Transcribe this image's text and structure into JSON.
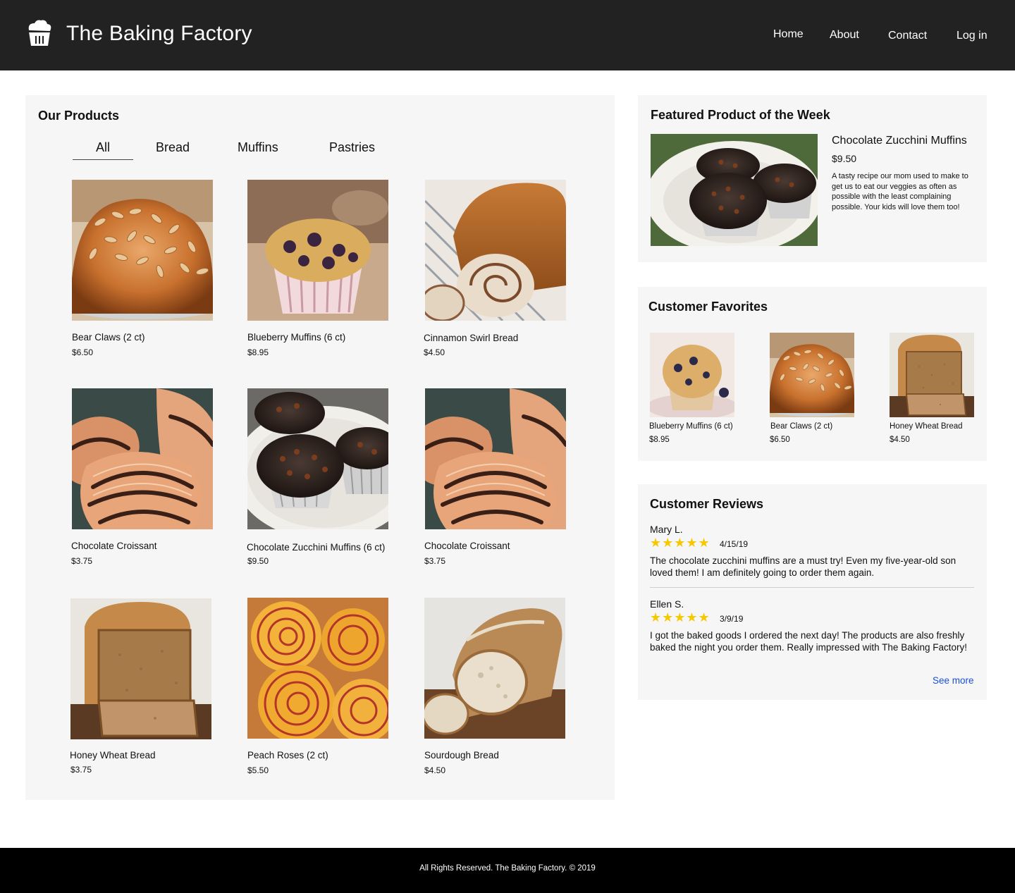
{
  "header": {
    "brand": "The Baking Factory",
    "logo_icon": "cupcake-icon",
    "nav": [
      "Home",
      "About",
      "Contact",
      "Log in"
    ]
  },
  "products": {
    "title": "Our Products",
    "tabs": [
      "All",
      "Bread",
      "Muffins",
      "Pastries"
    ],
    "active_tab": "All",
    "items": [
      {
        "name": "Bear Claws (2 ct)",
        "price": "$6.50",
        "image": "bear-claw-image"
      },
      {
        "name": "Blueberry Muffins (6 ct)",
        "price": "$8.95",
        "image": "blueberry-muffin-image"
      },
      {
        "name": "Cinnamon Swirl Bread",
        "price": "$4.50",
        "image": "cinnamon-swirl-bread-image"
      },
      {
        "name": "Chocolate Croissant",
        "price": "$3.75",
        "image": "chocolate-croissant-image"
      },
      {
        "name": "Chocolate Zucchini Muffins (6 ct)",
        "price": "$9.50",
        "image": "chocolate-muffin-image"
      },
      {
        "name": "Chocolate Croissant",
        "price": "$3.75",
        "image": "chocolate-croissant-image"
      },
      {
        "name": "Honey Wheat Bread",
        "price": "$3.75",
        "image": "honey-wheat-bread-image"
      },
      {
        "name": "Peach Roses (2 ct)",
        "price": "$5.50",
        "image": "peach-roses-image"
      },
      {
        "name": "Sourdough Bread",
        "price": "$4.50",
        "image": "sourdough-bread-image"
      }
    ]
  },
  "featured": {
    "title": "Featured Product of the Week",
    "name": "Chocolate Zucchini Muffins",
    "price": "$9.50",
    "description": "A tasty recipe our mom used to make to get us to eat our veggies as often as possible with the least complaining possible. Your kids will love them too!"
  },
  "favorites": {
    "title": "Customer Favorites",
    "items": [
      {
        "name": "Blueberry Muffins (6 ct)",
        "price": "$8.95"
      },
      {
        "name": "Bear Claws (2 ct)",
        "price": "$6.50"
      },
      {
        "name": "Honey Wheat Bread",
        "price": "$4.50"
      }
    ]
  },
  "reviews": {
    "title": "Customer Reviews",
    "items": [
      {
        "author": "Mary L.",
        "stars": "★★★★★",
        "rating": 5,
        "date": "4/15/19",
        "text": "The chocolate zucchini muffins are a must try! Even my five-year-old son loved them! I am definitely going to order them again."
      },
      {
        "author": "Ellen S.",
        "stars": "★★★★★",
        "rating": 5,
        "date": "3/9/19",
        "text": "I got the baked goods I ordered the next day! The products are also freshly baked the night you order them. Really impressed with The Baking Factory!"
      }
    ],
    "see_more": "See more"
  },
  "footer": {
    "text": "All Rights Reserved. The Baking Factory. © 2019"
  },
  "colors": {
    "header_bg": "#222222",
    "panel_bg": "#f6f6f6",
    "footer_bg": "#000000",
    "star": "#f5c800",
    "link": "#1a4fd6"
  }
}
